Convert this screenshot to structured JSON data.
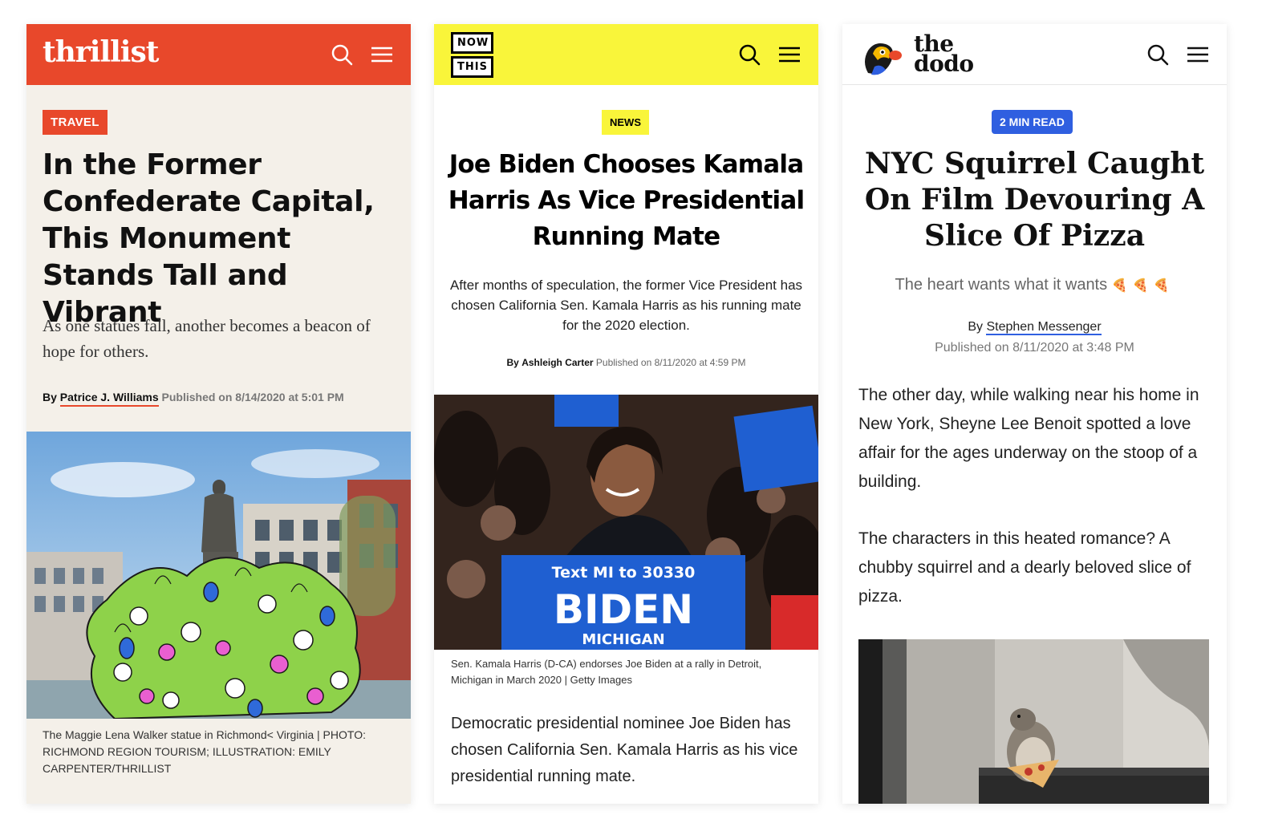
{
  "cards": [
    {
      "brand": "thrillist",
      "logo_text": "thrillist",
      "tag": "TRAVEL",
      "headline": "In the Former Confederate Capital, This Monument Stands Tall and Vibrant",
      "dek": "As one statues fall, another becomes a beacon of hope for others.",
      "byline_prefix": "By",
      "author": "Patrice J. Williams",
      "published": "Published on 8/14/2020 at 5:01 PM",
      "caption": "The Maggie Lena Walker statue in Richmond< Virginia",
      "credit": "| PHOTO: RICHMOND REGION TOURISM; ILLUSTRATION: EMILY CARPENTER/THRILLIST",
      "colors": {
        "brand": "#e8482b",
        "background": "#f4f0e9"
      },
      "icons": [
        "search-icon",
        "menu-icon"
      ]
    },
    {
      "brand": "nowthis",
      "logo_line1": "NOW",
      "logo_line2": "THIS",
      "tag": "NEWS",
      "headline": "Joe Biden Chooses Kamala Harris As Vice Presidential Running Mate",
      "dek": "After months of speculation, the former Vice President has chosen California Sen. Kamala Harris as his running mate for the 2020 election.",
      "byline_prefix": "By",
      "author": "Ashleigh Carter",
      "published": "Published on 8/11/2020 at 4:59 PM",
      "image_sign_top": "Text MI to 30330",
      "image_sign_main": "BIDEN",
      "image_sign_bottom": "MICHIGAN",
      "caption": "Sen. Kamala Harris (D-CA) endorses Joe Biden at a rally in Detroit, Michigan in March 2020",
      "credit": "| Getty Images",
      "body": "Democratic presidential nominee Joe Biden has chosen California Sen. Kamala Harris as his vice presidential running mate.",
      "colors": {
        "brand": "#f9f53a"
      },
      "icons": [
        "search-icon",
        "menu-icon"
      ]
    },
    {
      "brand": "the dodo",
      "logo_line1": "the",
      "logo_line2": "dodo",
      "tag": "2 MIN READ",
      "headline": "NYC Squirrel Caught On Film Devouring A Slice Of Pizza",
      "dek": "The heart wants what it wants",
      "dek_emoji": "🍕🍕🍕",
      "byline_prefix": "By",
      "author": "Stephen Messenger",
      "published": "Published on 8/11/2020 at 3:48 PM",
      "body": [
        "The other day, while walking near his home in New York, Sheyne Lee Benoit spotted a love affair for the ages underway on the stoop of a building.",
        "The characters in this heated romance? A chubby squirrel and a dearly beloved slice of pizza."
      ],
      "colors": {
        "brand": "#2f5fe0"
      },
      "icons": [
        "search-icon",
        "menu-icon"
      ]
    }
  ]
}
